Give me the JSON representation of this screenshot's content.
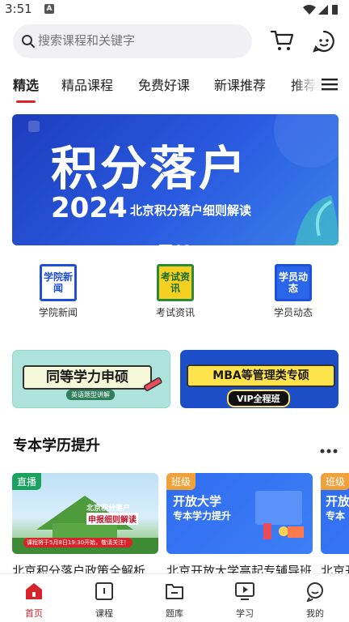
{
  "status_bar": {
    "time": "3:51",
    "notification_letter": "A"
  },
  "search": {
    "placeholder": "搜索课程和关键字"
  },
  "tabs": [
    {
      "label": "精选",
      "active": true
    },
    {
      "label": "精品课程",
      "active": false
    },
    {
      "label": "免费好课",
      "active": false
    },
    {
      "label": "新课推荐",
      "active": false
    },
    {
      "label": "推荐",
      "active": false
    }
  ],
  "banner": {
    "title": "积分落户",
    "year": "2024",
    "subtitle": "北京积分落户细则解读",
    "slide_count": 3,
    "active_slide": 1
  },
  "quick_links": [
    {
      "icon_text": "学院新闻",
      "label": "学院新闻",
      "icon": "news-icon",
      "color": "#1e4fd8",
      "bg": "#ffffff"
    },
    {
      "icon_text": "考试资讯",
      "label": "考试资讯",
      "icon": "exam-info-icon",
      "color": "#2a8c3a",
      "bg": "#f5d020"
    },
    {
      "icon_text": "学员动态",
      "label": "学员动态",
      "icon": "student-news-icon",
      "color": "#1e4fd8",
      "bg": "#ffffff"
    }
  ],
  "promos": [
    {
      "title": "同等学力申硕",
      "subtitle": "英语题型讲解"
    },
    {
      "title": "MBA等管理类专硕",
      "subtitle": "VIP全程班"
    }
  ],
  "section": {
    "title": "专本学历提升"
  },
  "courses": [
    {
      "badge": "直播",
      "badge_color": "#1aa260",
      "thumb_main": "北京积分落户",
      "thumb_sub": "申报细则解读",
      "thumb_note": "课程将于5月8日19:30开始，敬请关注！",
      "title": "北京积分落户政策全解析"
    },
    {
      "badge": "班级",
      "badge_color": "#f0a23a",
      "thumb_main": "开放大学",
      "thumb_sub": "专本学力提升",
      "thumb_note": "",
      "title": "北京开放大学高起专辅导班"
    },
    {
      "badge": "班级",
      "badge_color": "#f0a23a",
      "thumb_main": "开放",
      "thumb_sub": "专本",
      "thumb_note": "",
      "title": "北京开放大学"
    }
  ],
  "bottom_nav": [
    {
      "label": "首页",
      "icon": "home-icon",
      "active": true
    },
    {
      "label": "课程",
      "icon": "course-icon",
      "active": false
    },
    {
      "label": "题库",
      "icon": "question-bank-icon",
      "active": false
    },
    {
      "label": "学习",
      "icon": "study-icon",
      "active": false
    },
    {
      "label": "我的",
      "icon": "profile-icon",
      "active": false
    }
  ],
  "colors": {
    "accent": "#d8232a",
    "banner_blue": "#2a5be0"
  }
}
